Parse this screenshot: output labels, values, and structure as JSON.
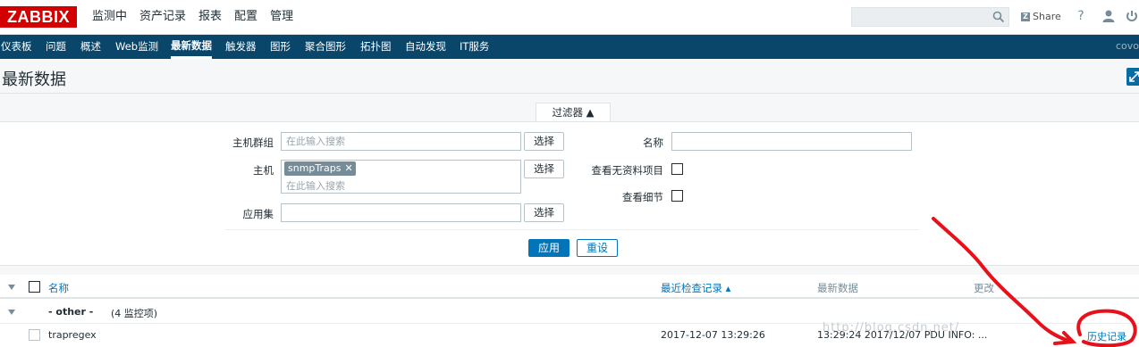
{
  "header": {
    "logo": "ZABBIX",
    "menu": [
      "监测中",
      "资产记录",
      "报表",
      "配置",
      "管理"
    ],
    "share_label": "Share",
    "share_letter": "Z",
    "help_label": "?"
  },
  "submenu": {
    "items": [
      "仪表板",
      "问题",
      "概述",
      "Web监测",
      "最新数据",
      "触发器",
      "图形",
      "聚合图形",
      "拓扑图",
      "自动发现",
      "IT服务"
    ],
    "active": "最新数据",
    "user": "covo"
  },
  "page": {
    "title": "最新数据"
  },
  "filter": {
    "tab_label": "过滤器 ▲",
    "host_group_label": "主机群组",
    "host_group_placeholder": "在此输入搜索",
    "select_label": "选择",
    "host_label": "主机",
    "host_tag": "snmpTraps",
    "host_tag_remove": "✕",
    "host_placeholder": "在此输入搜索",
    "app_label": "应用集",
    "name_label": "名称",
    "no_data_label": "查看无资料项目",
    "details_label": "查看细节",
    "apply_label": "应用",
    "reset_label": "重设"
  },
  "table": {
    "col_name": "名称",
    "col_last_check": "最近检查记录 ▴",
    "col_last_value": "最新数据",
    "col_change": "更改",
    "group_label": "- other -",
    "group_count": "(4 监控项)",
    "rows": [
      {
        "name": "trapregex",
        "last_check": "2017-12-07 13:29:26",
        "last_value": "13:29:24 2017/12/07 PDU INFO: ...",
        "action": "历史记录"
      }
    ]
  },
  "watermark": "http://blog.csdn.net/"
}
